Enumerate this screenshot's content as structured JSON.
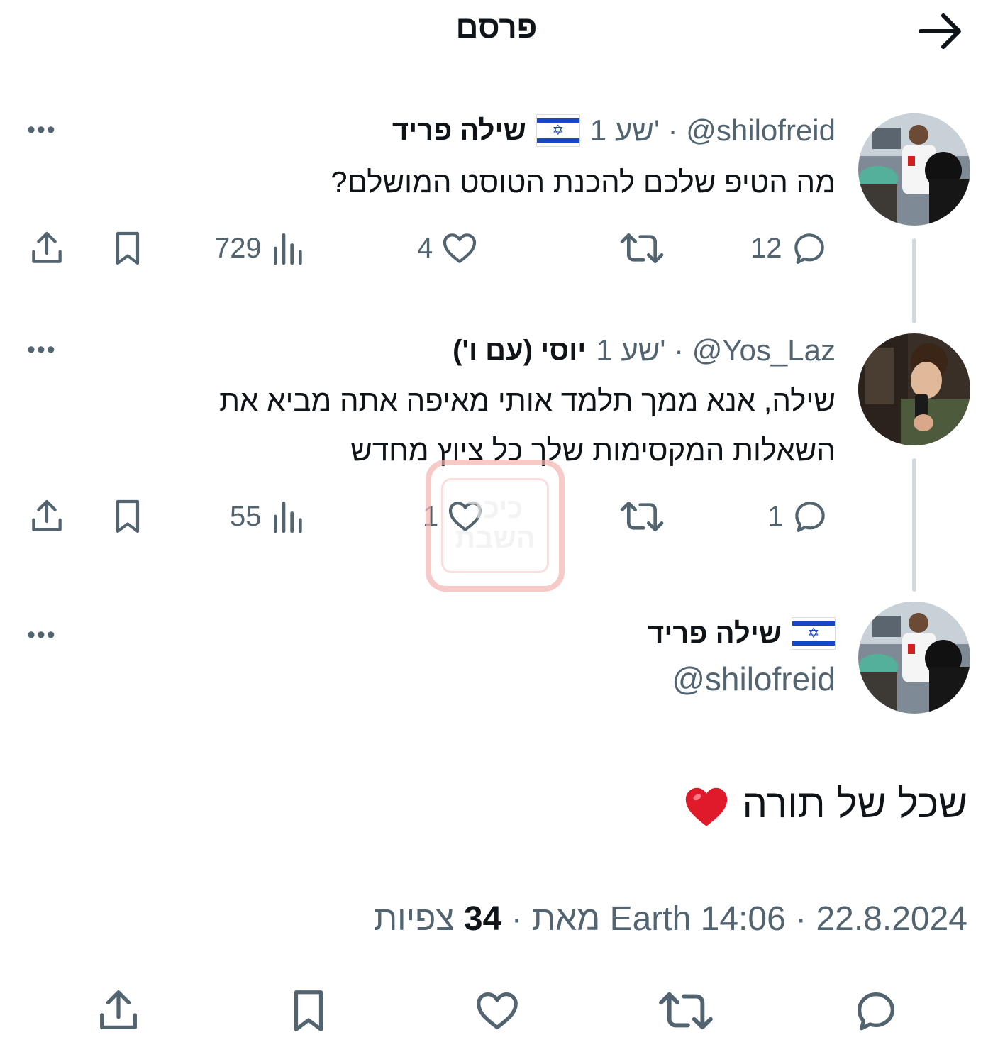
{
  "header": {
    "title": "פרסם"
  },
  "tweets": [
    {
      "display_name": "שילה פריד",
      "flag": "🇮🇱",
      "handle_time": "1 שע' · @shilofreid",
      "text_lines": [
        "מה הטיפ שלכם להכנת הטוסט המושלם?"
      ],
      "replies": "12",
      "retweets": "",
      "likes": "4",
      "views": "729"
    },
    {
      "display_name": "יוסי (עם ו')",
      "handle_time": "1 שע' · @Yos_Laz",
      "text_lines": [
        "שילה, אנא ממך תלמד אותי מאיפה אתה מביא את",
        "השאלות המקסימות שלך כל ציוץ מחדש"
      ],
      "replies": "1",
      "retweets": "",
      "likes": "1",
      "views": "55"
    }
  ],
  "main_post": {
    "display_name": "שילה פריד",
    "flag": "🇮🇱",
    "handle": "@shilofreid",
    "text": "שכל של תורה",
    "emoji": "red-heart",
    "date": "22.8.2024",
    "time": "14:06",
    "source": "Earth מאת",
    "views_count": "34",
    "views_label": "צפיות"
  },
  "watermark": {
    "line1": "כיכר",
    "line2": "השבת"
  },
  "icons": [
    "back-arrow-icon",
    "more-icon",
    "reply-icon",
    "retweet-icon",
    "like-icon",
    "views-icon",
    "bookmark-icon",
    "share-icon"
  ],
  "colors": {
    "text": "#0f1419",
    "secondary": "#536471",
    "thread_line": "#cfd9de",
    "watermark": "#f3b4b0"
  }
}
